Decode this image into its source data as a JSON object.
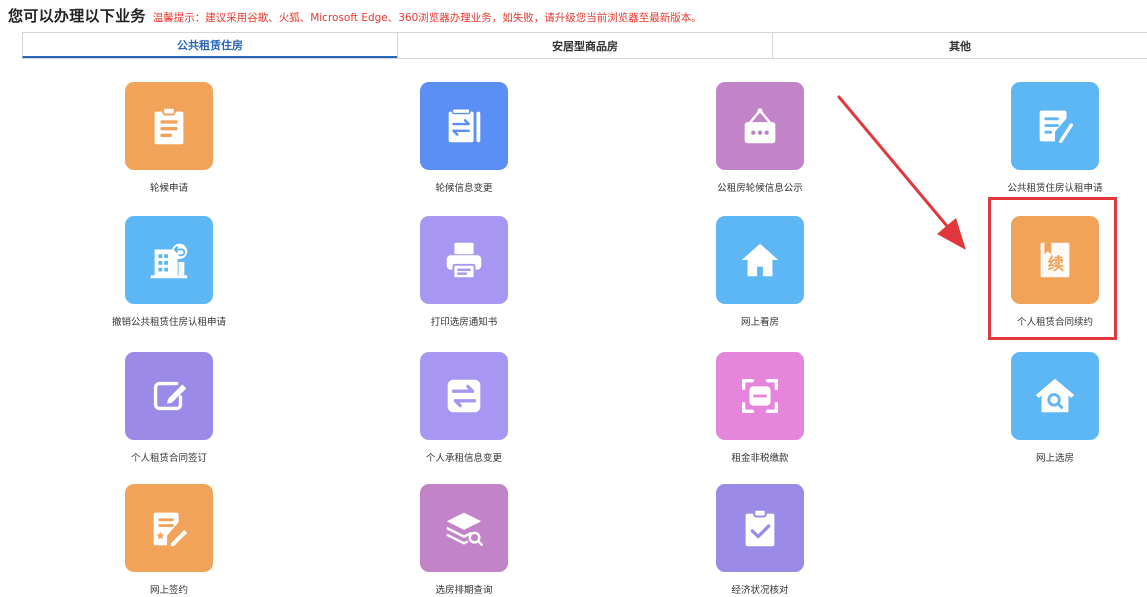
{
  "header": {
    "title": "您可以办理以下业务",
    "tip": "温馨提示：建议采用谷歌、火狐、Microsoft Edge、360浏览器办理业务，如失败，请升级您当前浏览器至最新版本。"
  },
  "tabs": [
    {
      "label": "公共租赁住房",
      "active": true
    },
    {
      "label": "安居型商品房",
      "active": false
    },
    {
      "label": "其他",
      "active": false
    }
  ],
  "colors": {
    "accent": "#2a66b8",
    "tip": "#e8382f",
    "highlight": "#e0383c",
    "orange": "#f2a35a",
    "blue": "#5b8ff5",
    "sky": "#5eb7f5",
    "mauve": "#c283c9",
    "violet": "#a897f2",
    "lavender": "#9c8ae8",
    "pink": "#e586dc"
  },
  "services": [
    {
      "label": "轮候申请",
      "icon": "clipboard-list-icon"
    },
    {
      "label": "轮候信息变更",
      "icon": "swap-document-icon"
    },
    {
      "label": "公租房轮候信息公示",
      "icon": "notice-board-icon"
    },
    {
      "label": "公共租赁住房认租申请",
      "icon": "document-edit-icon"
    },
    {
      "label": "撤销公共租赁住房认租申请",
      "icon": "building-undo-icon"
    },
    {
      "label": "打印选房通知书",
      "icon": "printer-icon"
    },
    {
      "label": "网上看房",
      "icon": "house-icon"
    },
    {
      "label": "个人租赁合同续约",
      "icon": "renewal-book-icon",
      "glyph": "续"
    },
    {
      "label": "个人租赁合同签订",
      "icon": "sign-edit-icon"
    },
    {
      "label": "个人承租信息变更",
      "icon": "exchange-arrows-icon"
    },
    {
      "label": "租金非税缴款",
      "icon": "scan-payment-icon"
    },
    {
      "label": "网上选房",
      "icon": "house-search-icon"
    },
    {
      "label": "网上签约",
      "icon": "document-star-pen-icon"
    },
    {
      "label": "选房排期查询",
      "icon": "layers-search-icon"
    },
    {
      "label": "经济状况核对",
      "icon": "clipboard-check-icon"
    }
  ]
}
